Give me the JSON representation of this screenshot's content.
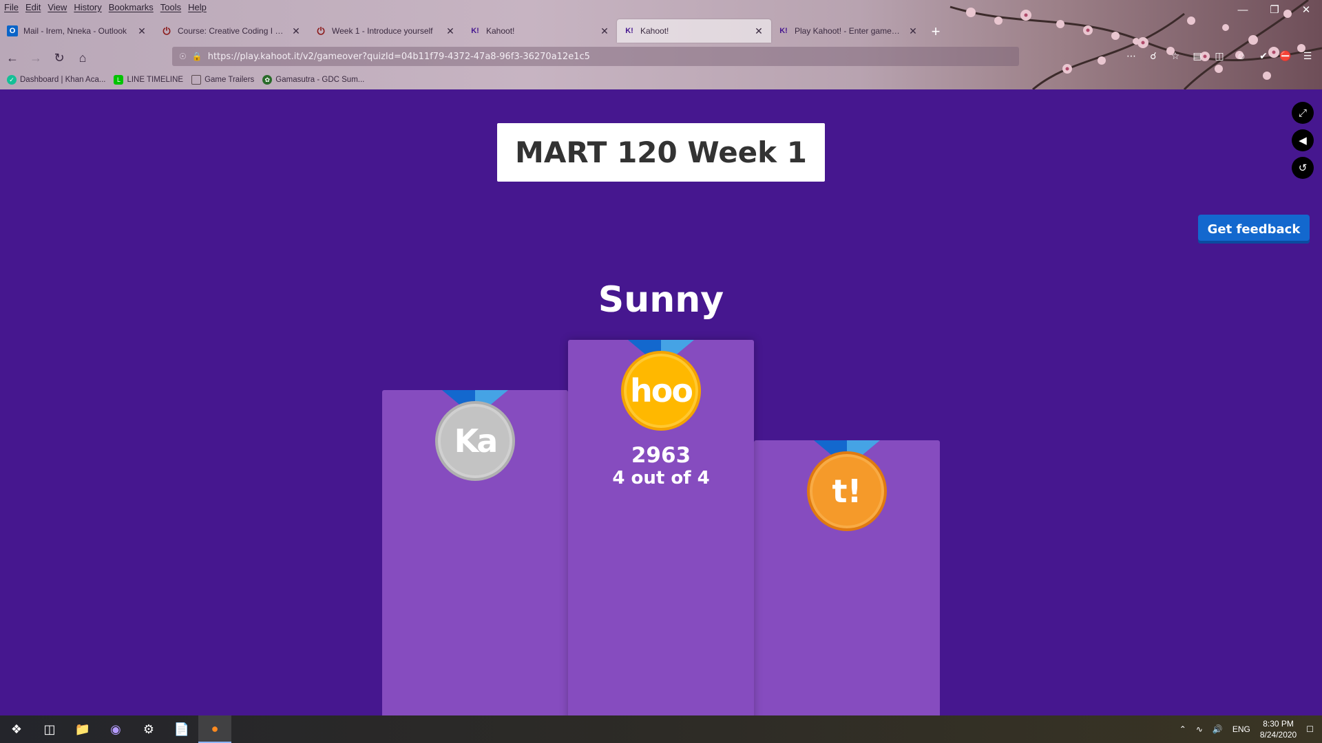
{
  "menu": [
    "File",
    "Edit",
    "View",
    "History",
    "Bookmarks",
    "Tools",
    "Help"
  ],
  "tabs": [
    {
      "title": "Mail - Irem, Nneka - Outlook",
      "favicon": "outlook-icon"
    },
    {
      "title": "Course: Creative Coding I (Sec",
      "favicon": "canvas-icon"
    },
    {
      "title": "Week 1 - Introduce yourself",
      "favicon": "canvas-icon"
    },
    {
      "title": "Kahoot!",
      "favicon": "kahoot-icon"
    },
    {
      "title": "Kahoot!",
      "favicon": "kahoot-icon",
      "active": true
    },
    {
      "title": "Play Kahoot! - Enter game PIN",
      "favicon": "kahoot-icon"
    }
  ],
  "url": "https://play.kahoot.it/v2/gameover?quizId=04b11f79-4372-47a8-96f3-36270a12e1c5",
  "bookmarks": [
    {
      "label": "Dashboard | Khan Aca...",
      "color": "#14bf96"
    },
    {
      "label": "LINE TIMELINE",
      "color": "#00c300"
    },
    {
      "label": "Game Trailers",
      "color": "#8a7a60"
    },
    {
      "label": "Gamasutra - GDC Sum...",
      "color": "#2a6b2a"
    }
  ],
  "kahoot": {
    "quiz_title": "MART 120 Week 1",
    "feedback_label": "Get feedback",
    "winner_name": "Sunny",
    "first": {
      "medal_text": "hoo",
      "score": "2963",
      "correct": "4 out of 4"
    },
    "second": {
      "medal_text": "Ka"
    },
    "third": {
      "medal_text": "t!"
    }
  },
  "taskbar": {
    "lang": "ENG",
    "time": "8:30 PM",
    "date": "8/24/2020"
  },
  "colors": {
    "background": "#46178f",
    "podium": "#864cbf",
    "gold": "#ffb800",
    "silver": "#c3c3c3",
    "bronze": "#f59a2a",
    "feedback_button": "#1368ce"
  }
}
